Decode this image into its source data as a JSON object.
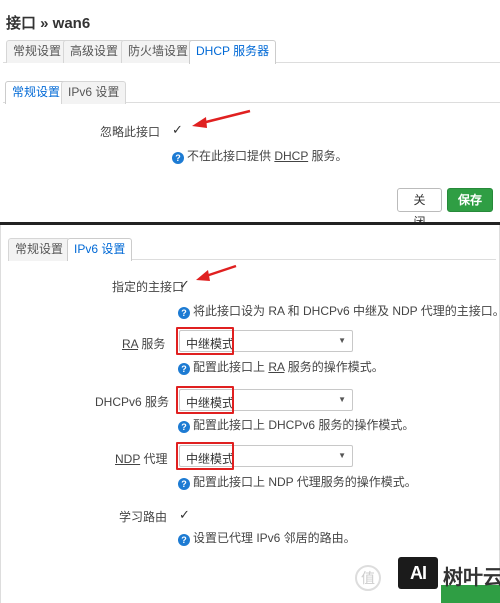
{
  "top_panel": {
    "title": "接口 » wan6",
    "main_tabs": [
      {
        "label": "常规设置",
        "active": false
      },
      {
        "label": "高级设置",
        "active": false
      },
      {
        "label": "防火墙设置",
        "active": false
      },
      {
        "label": "DHCP 服务器",
        "active": true
      }
    ],
    "sub_tabs": [
      {
        "label": "常规设置",
        "active": true
      },
      {
        "label": "IPv6 设置",
        "active": false
      }
    ],
    "ignore_interface": {
      "label": "忽略此接口",
      "checked": true,
      "help_prefix": "不在此接口提供 ",
      "help_abbr": "DHCP",
      "help_suffix": " 服务。"
    },
    "buttons": {
      "close": "关闭",
      "save": "保存"
    }
  },
  "bottom_panel": {
    "tabs": [
      {
        "label": "常规设置",
        "active": false
      },
      {
        "label": "IPv6 设置",
        "active": true
      }
    ],
    "master": {
      "label": "指定的主接口",
      "checked": true,
      "help": "将此接口设为 RA 和 DHCPv6 中继及 NDP 代理的主接口。"
    },
    "ra": {
      "label_abbr": "RA",
      "label_suffix": " 服务",
      "value": "中继模式",
      "help_prefix": "配置此接口上 ",
      "help_abbr": "RA",
      "help_suffix": " 服务的操作模式。"
    },
    "dhcpv6": {
      "label": "DHCPv6 服务",
      "value": "中继模式",
      "help": "配置此接口上 DHCPv6 服务的操作模式。"
    },
    "ndp": {
      "label_abbr": "NDP",
      "label_suffix": " 代理",
      "value": "中继模式",
      "help": "配置此接口上 NDP 代理服务的操作模式。"
    },
    "learn_routes": {
      "label": "学习路由",
      "checked": true,
      "help": "设置已代理 IPv6 邻居的路由。"
    }
  },
  "watermark": {
    "logo": "AI",
    "text": "树叶云",
    "circle": "值"
  },
  "icons": {
    "checkmark": "✓",
    "help": "?",
    "caret": "▼"
  },
  "colors": {
    "accent": "#0069d6",
    "save": "#2f9e44",
    "highlight": "#e02020",
    "help_icon": "#1d7bd3"
  }
}
